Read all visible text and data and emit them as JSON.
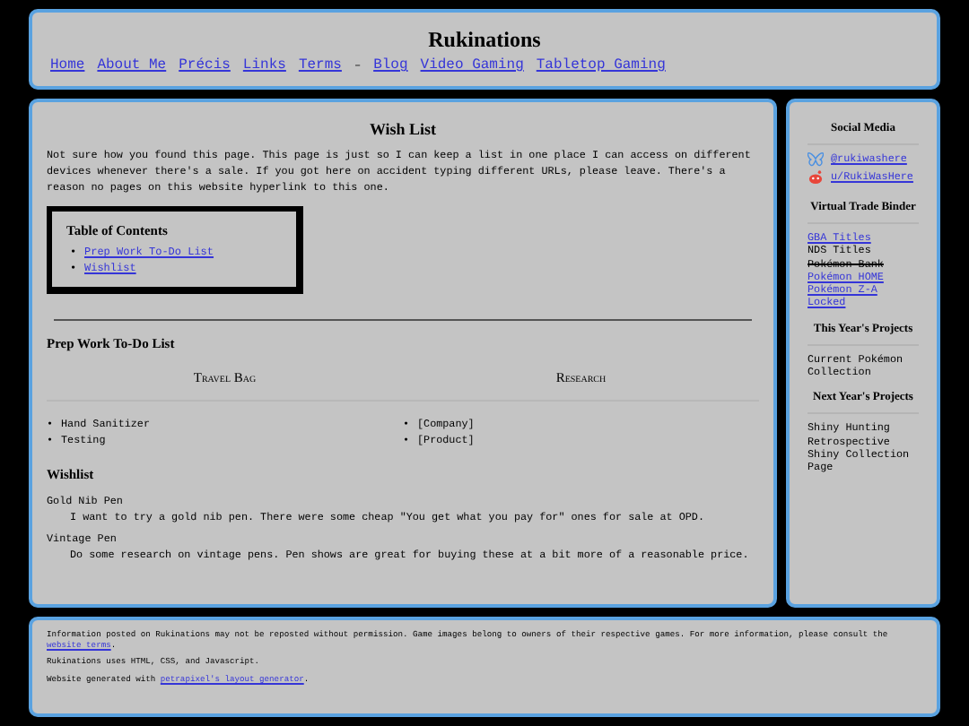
{
  "header": {
    "title": "Rukinations",
    "nav": [
      {
        "label": "Home",
        "kind": "link"
      },
      {
        "label": "About Me",
        "kind": "link"
      },
      {
        "label": "Précis",
        "kind": "link"
      },
      {
        "label": "Links",
        "kind": "link"
      },
      {
        "label": "Terms",
        "kind": "link"
      },
      {
        "label": "–",
        "kind": "separator"
      },
      {
        "label": "Blog",
        "kind": "link"
      },
      {
        "label": "Video Gaming",
        "kind": "link"
      },
      {
        "label": "Tabletop Gaming",
        "kind": "link"
      }
    ]
  },
  "main": {
    "title": "Wish List",
    "intro": "Not sure how you found this page. This page is just so I can keep a list in one place I can access on different devices whenever there's a sale. If you got here on accident typing different URLs, please leave. There's a reason no pages on this website hyperlink to this one.",
    "toc": {
      "title": "Table of Contents",
      "bullet": "•",
      "items": [
        "Prep Work To-Do List",
        "Wishlist"
      ]
    },
    "prep": {
      "title": "Prep Work To-Do List",
      "bullet": "•",
      "columns": [
        {
          "heading": "Travel Bag",
          "items": [
            "Hand Sanitizer",
            "Testing"
          ]
        },
        {
          "heading": "Research",
          "items": [
            "[Company]",
            "[Product]"
          ]
        }
      ]
    },
    "wishlist": {
      "title": "Wishlist",
      "entries": [
        {
          "term": "Gold Nib Pen",
          "description": "I want to try a gold nib pen. There were some cheap \"You get what you pay for\" ones for sale at OPD."
        },
        {
          "term": "Vintage Pen",
          "description": "Do some research on vintage pens. Pen shows are great for buying these at a bit more of a reasonable price."
        }
      ]
    }
  },
  "sidebar": {
    "sections": [
      {
        "title": "Social Media",
        "items": [
          {
            "label": "@rukiwashere",
            "kind": "butterfly"
          },
          {
            "label": "u/RukiWasHere",
            "kind": "reddit"
          }
        ]
      },
      {
        "title": "Virtual Trade Binder",
        "items": [
          {
            "label": "GBA Titles",
            "kind": "link"
          },
          {
            "label": "NDS Titles",
            "kind": "plain"
          },
          {
            "label": "Pokémon Bank",
            "kind": "struck"
          },
          {
            "label": "Pokémon HOME",
            "kind": "link"
          },
          {
            "label": "Pokémon Z-A Locked",
            "kind": "link"
          }
        ]
      },
      {
        "title": "This Year's Projects",
        "items": [
          {
            "label": "Current Pokémon Collection",
            "kind": "plain"
          }
        ]
      },
      {
        "title": "Next Year's Projects",
        "items": [
          {
            "label": "Shiny Hunting Retrospective Shiny Collection Page",
            "kind": "plain"
          }
        ]
      }
    ]
  },
  "footer": {
    "paragraphs": [
      {
        "text": "Information posted on Rukinations may not be reposted without permission. Game images belong to owners of their respective games. For more information, please consult the",
        "link": "website terms",
        "after": "."
      },
      {
        "text": "Rukinations uses HTML, CSS, and Javascript."
      },
      {
        "text": "Website generated with",
        "link": "petrapixel's layout generator",
        "after": "."
      }
    ]
  }
}
